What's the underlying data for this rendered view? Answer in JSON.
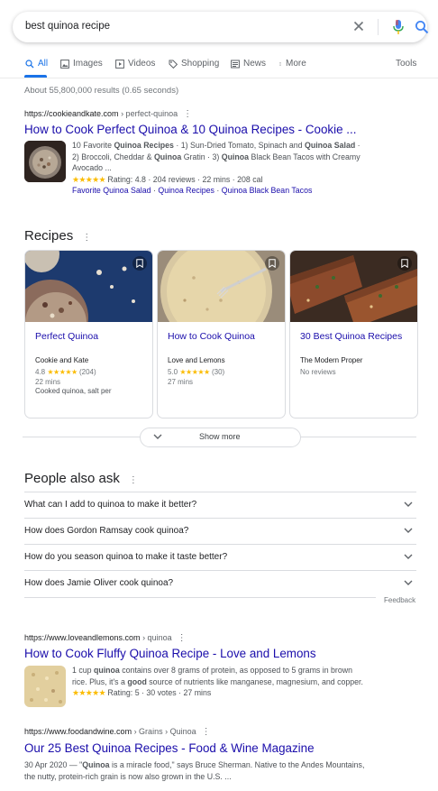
{
  "search": {
    "query": "best quinoa recipe"
  },
  "tabs": [
    {
      "label": "All",
      "icon": "search-icon"
    },
    {
      "label": "Images",
      "icon": "image-icon"
    },
    {
      "label": "Videos",
      "icon": "video-icon"
    },
    {
      "label": "Shopping",
      "icon": "tag-icon"
    },
    {
      "label": "News",
      "icon": "news-icon"
    },
    {
      "label": "More",
      "icon": "more-vert-icon"
    }
  ],
  "tools_label": "Tools",
  "stats": "About 55,800,000 results (0.65 seconds)",
  "result1": {
    "cite_domain": "https://cookieandkate.com",
    "cite_path": " › perfect-quinoa",
    "title": "How to Cook Perfect Quinoa & 10 Quinoa Recipes - Cookie ...",
    "snippet_line1a": "10 Favorite ",
    "snippet_line1b": "Quinoa Recipes",
    "snippet_line1c": " · 1) Sun-Dried Tomato, Spinach and ",
    "snippet_line1d": "Quinoa Salad",
    "snippet_line1e": " ·",
    "snippet_line2a": "2) Broccoli, Cheddar & ",
    "snippet_line2b": "Quinoa",
    "snippet_line2c": " Gratin · 3) ",
    "snippet_line2d": "Quinoa",
    "snippet_line2e": " Black Bean Tacos with Creamy",
    "snippet_line3": "Avocado ...",
    "stars": "★★★★★",
    "rating": " Rating: 4.8 · 204 reviews · 22 mins · 208 cal",
    "sitelinks": [
      "Favorite Quinoa Salad",
      "Quinoa Recipes",
      "Quinoa Black Bean Tacos"
    ],
    "sitelink_sep": " · "
  },
  "recipes": {
    "heading": "Recipes",
    "cards": [
      {
        "title": "Perfect Quinoa",
        "source": "Cookie and Kate",
        "rating": "4.8",
        "stars": "★★★★★",
        "count": "(204)",
        "time": "22 mins",
        "ingredients": "Cooked quinoa, salt per"
      },
      {
        "title": "How to Cook Quinoa",
        "source": "Love and Lemons",
        "rating": "5.0",
        "stars": "★★★★★",
        "count": "(30)",
        "time": "27 mins",
        "ingredients": ""
      },
      {
        "title": "30 Best Quinoa Recipes",
        "source": "The Modern Proper",
        "rating": "",
        "stars": "",
        "count": "",
        "time": "No reviews",
        "ingredients": ""
      }
    ],
    "show_more": "Show more"
  },
  "paa": {
    "heading": "People also ask",
    "questions": [
      "What can I add to quinoa to make it better?",
      "How does Gordon Ramsay cook quinoa?",
      "How do you season quinoa to make it taste better?",
      "How does Jamie Oliver cook quinoa?"
    ],
    "feedback": "Feedback"
  },
  "result2": {
    "cite_domain": "https://www.loveandlemons.com",
    "cite_path": " › quinoa",
    "title": "How to Cook Fluffy Quinoa Recipe - Love and Lemons",
    "s1a": "1 cup ",
    "s1b": "quinoa",
    "s1c": " contains over 8 grams of protein, as opposed to 5 grams in brown",
    "s2a": "rice. Plus, it's a ",
    "s2b": "good",
    "s2c": " source of nutrients like manganese, magnesium, and copper.",
    "stars": "★★★★★",
    "rating": " Rating: 5 · 30 votes · 27 mins"
  },
  "result3": {
    "cite_domain": "https://www.foodandwine.com",
    "cite_path": " › Grains › Quinoa",
    "title": "Our 25 Best Quinoa Recipes - Food & Wine Magazine",
    "s1a": "30 Apr 2020 — \"",
    "s1b": "Quinoa",
    "s1c": " is a miracle food,\" says Bruce Sherman. Native to the Andes Mountains,",
    "s2": "the nutty, protein-rich grain is now also grown in the U.S. ..."
  },
  "colors": {
    "link": "#1a0dab",
    "accent": "#1a73e8",
    "star": "#fbbc04"
  }
}
